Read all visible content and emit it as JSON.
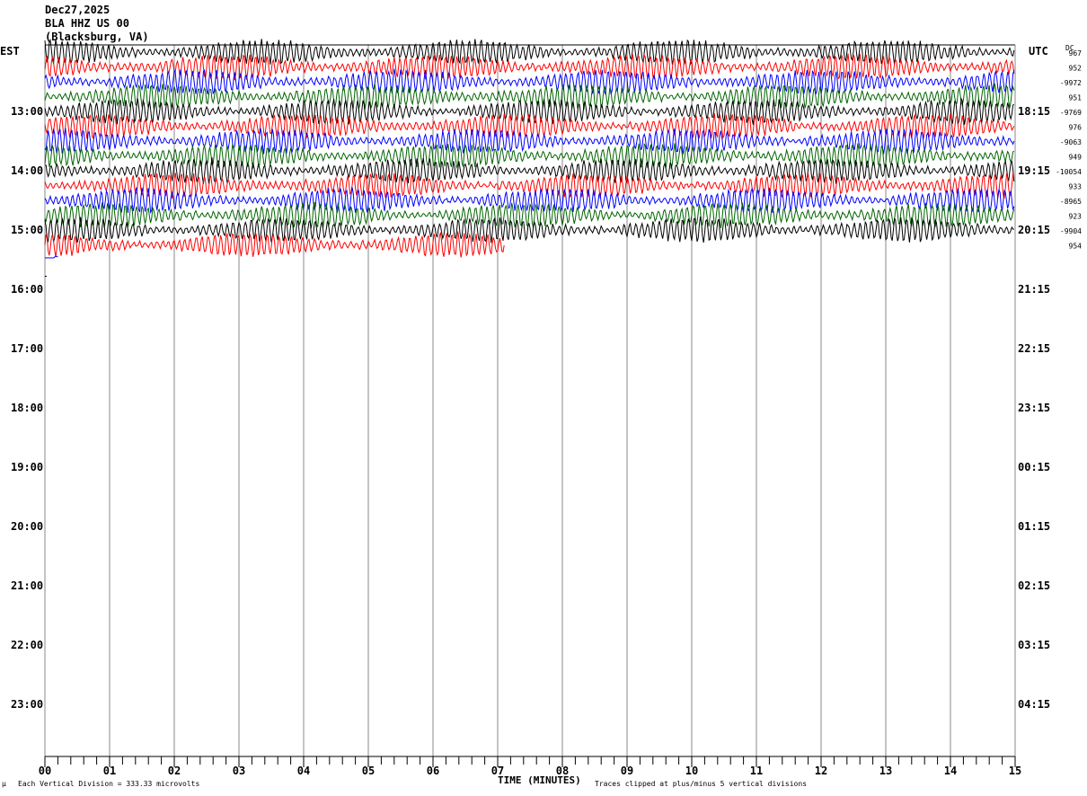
{
  "header": {
    "date": "Dec27,2025",
    "station": "BLA HHZ US 00",
    "location": "(Blacksburg, VA)"
  },
  "left_zone": "EST",
  "right_zone": "UTC",
  "dc_label": "DC",
  "footer": {
    "scale": "Each Vertical Division =  333.33 microvolts",
    "xlabel": "TIME (MINUTES)",
    "clip": "Traces clipped at plus/minus 5 vertical divisions"
  },
  "chart_data": {
    "type": "line",
    "xlabel": "TIME (MINUTES)",
    "xlim": [
      0,
      15
    ],
    "x_ticks": [
      "00",
      "01",
      "02",
      "03",
      "04",
      "05",
      "06",
      "07",
      "08",
      "09",
      "10",
      "11",
      "12",
      "13",
      "14",
      "15"
    ],
    "left_hour_labels": [
      "13:00",
      "14:00",
      "15:00",
      "16:00",
      "17:00",
      "18:00",
      "19:00",
      "20:00",
      "21:00",
      "22:00",
      "23:00"
    ],
    "right_hour_labels": [
      "18:15",
      "19:15",
      "20:15",
      "21:15",
      "22:15",
      "23:15",
      "00:15",
      "01:15",
      "02:15",
      "03:15",
      "04:15"
    ],
    "trace_colors": [
      "#000000",
      "#ff0000",
      "#0000ff",
      "#006400"
    ],
    "rows_per_hour": 4,
    "grid": true,
    "rows": [
      {
        "dc": "967",
        "end_min": 15
      },
      {
        "dc": "952",
        "end_min": 15
      },
      {
        "dc": "-9972",
        "end_min": 15
      },
      {
        "dc": "951",
        "end_min": 15
      },
      {
        "dc": "-9769",
        "end_min": 15
      },
      {
        "dc": "976",
        "end_min": 15
      },
      {
        "dc": "-9063",
        "end_min": 15
      },
      {
        "dc": "949",
        "end_min": 15
      },
      {
        "dc": "-10054",
        "end_min": 15
      },
      {
        "dc": "933",
        "end_min": 15
      },
      {
        "dc": "-8965",
        "end_min": 15
      },
      {
        "dc": "923",
        "end_min": 15
      },
      {
        "dc": "-9904",
        "end_min": 15
      },
      {
        "dc": "954",
        "end_min": 7.1
      },
      {
        "dc": "",
        "end_min": 0.2
      },
      {
        "dc": "",
        "end_min": 0.02
      }
    ]
  }
}
